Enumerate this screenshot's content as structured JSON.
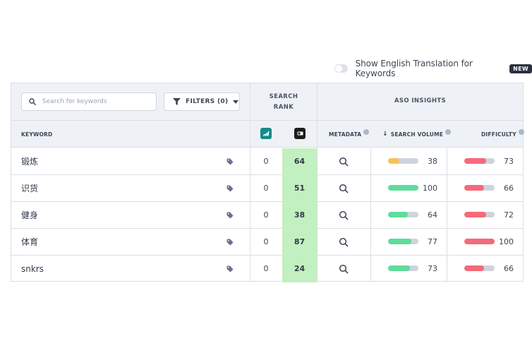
{
  "header": {
    "toggle_label": "Show English Translation for Keywords",
    "new_badge": "NEW"
  },
  "toolbar": {
    "search_placeholder": "Search for keywords",
    "filters_label": "FILTERS (0)"
  },
  "groups": {
    "search_rank": "SEARCH RANK",
    "aso_insights": "ASO INSIGHTS"
  },
  "columns": {
    "keyword": "KEYWORD",
    "metadata": "METADATA",
    "search_volume": "SEARCH VOLUME",
    "difficulty": "DIFFICULTY",
    "sort_arrow": "↓"
  },
  "colors": {
    "volume_low": "#f5c25a",
    "volume_high": "#5fdc9c",
    "difficulty": "#f56a7a",
    "rank_highlight": "#c3f0c0",
    "bar_track": "#cfd4dc"
  },
  "rows": [
    {
      "keyword": "锻炼",
      "rank_adidas": "0",
      "rank_nike": "64",
      "search_volume": "38",
      "volume_fraction": 0.38,
      "volume_color": "#f5c25a",
      "difficulty": "73",
      "difficulty_fraction": 0.73
    },
    {
      "keyword": "识货",
      "rank_adidas": "0",
      "rank_nike": "51",
      "search_volume": "100",
      "volume_fraction": 1.0,
      "volume_color": "#5fdc9c",
      "difficulty": "66",
      "difficulty_fraction": 0.66
    },
    {
      "keyword": "健身",
      "rank_adidas": "0",
      "rank_nike": "38",
      "search_volume": "64",
      "volume_fraction": 0.64,
      "volume_color": "#5fdc9c",
      "difficulty": "72",
      "difficulty_fraction": 0.72
    },
    {
      "keyword": "体育",
      "rank_adidas": "0",
      "rank_nike": "87",
      "search_volume": "77",
      "volume_fraction": 0.77,
      "volume_color": "#5fdc9c",
      "difficulty": "100",
      "difficulty_fraction": 1.0
    },
    {
      "keyword": "snkrs",
      "rank_adidas": "0",
      "rank_nike": "24",
      "search_volume": "73",
      "volume_fraction": 0.73,
      "volume_color": "#5fdc9c",
      "difficulty": "66",
      "difficulty_fraction": 0.66
    }
  ],
  "icons": {
    "search": "search-icon",
    "filter": "funnel-icon",
    "tag": "tag-icon",
    "metadata": "magnifier-icon",
    "app_a": "adidas-app-icon",
    "app_b": "nike-app-icon",
    "info": "info-icon"
  }
}
